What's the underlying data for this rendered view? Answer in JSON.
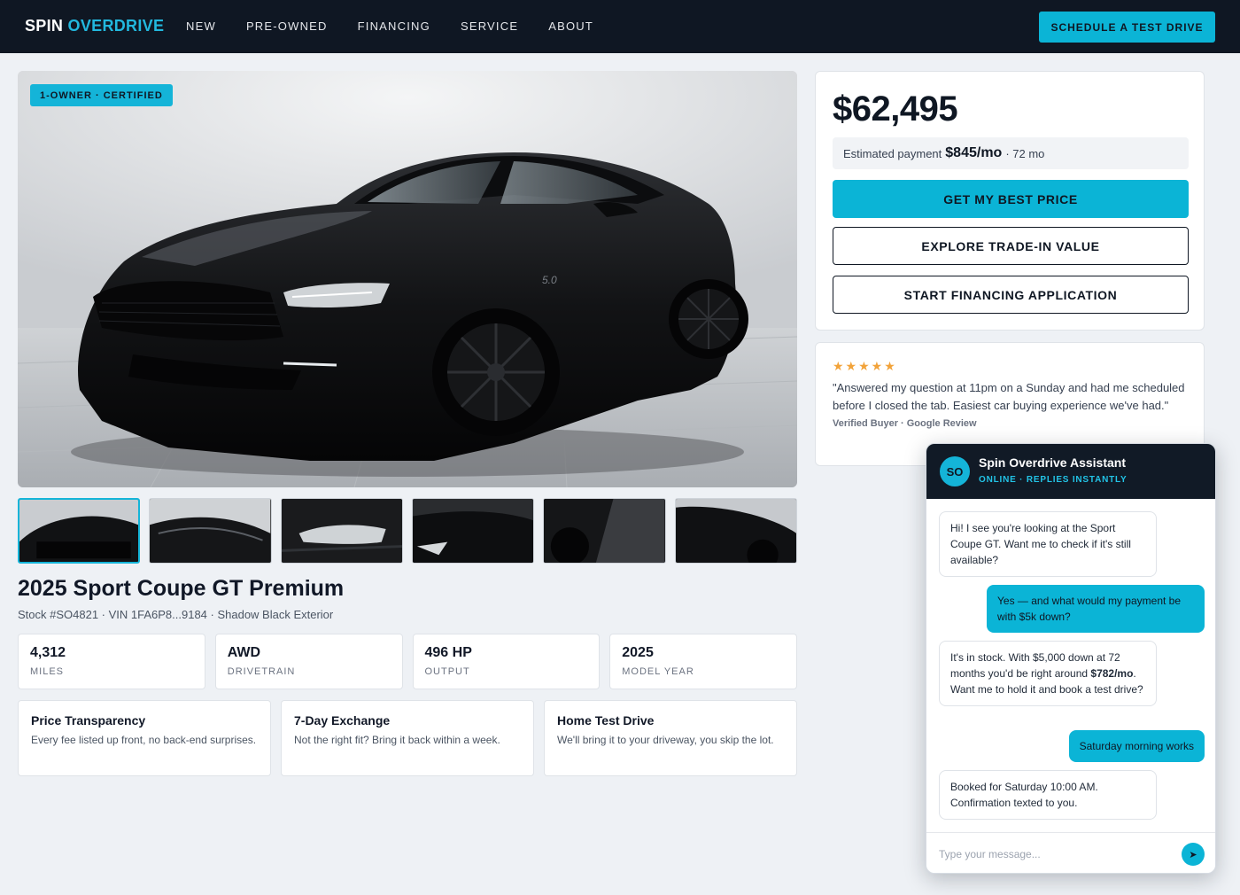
{
  "header": {
    "brand_primary": "SPIN",
    "brand_accent": "OVERDRIVE",
    "nav": [
      "NEW",
      "PRE-OWNED",
      "FINANCING",
      "SERVICE",
      "ABOUT"
    ],
    "cta": "SCHEDULE A TEST DRIVE"
  },
  "colors": {
    "accent": "#0bb4d6",
    "nav_bg": "#0f1723",
    "page_bg": "#eef1f5",
    "stars": "#f2a33a"
  },
  "listing": {
    "badge": "1-OWNER · CERTIFIED",
    "title": "2025 Sport Coupe GT Premium",
    "subtitle": "Stock #SO4821 · VIN 1FA6P8...9184 · Shadow Black Exterior",
    "thumbnail_count": 6,
    "specs": [
      {
        "value": "4,312",
        "label": "MILES"
      },
      {
        "value": "AWD",
        "label": "DRIVETRAIN"
      },
      {
        "value": "496 HP",
        "label": "OUTPUT"
      },
      {
        "value": "2025",
        "label": "MODEL YEAR"
      }
    ],
    "features": [
      {
        "title": "Price Transparency",
        "desc": "Every fee listed up front, no back-end surprises."
      },
      {
        "title": "7-Day Exchange",
        "desc": "Not the right fit? Bring it back within a week."
      },
      {
        "title": "Home Test Drive",
        "desc": "We'll bring it to your driveway, you skip the lot."
      }
    ]
  },
  "pricing": {
    "price": "$62,495",
    "est_label": "Estimated payment",
    "est_amount": "$845/mo",
    "est_term": "· 72 mo",
    "btn_best_price": "GET MY BEST PRICE",
    "btn_trade": "EXPLORE TRADE-IN VALUE",
    "btn_financing": "START FINANCING APPLICATION"
  },
  "review": {
    "stars": "★★★★★",
    "quote": "\"Answered my question at 11pm on a Sunday and had me scheduled before I closed the tab. Easiest car buying experience we've had.\"",
    "reviewer": "Verified Buyer · Google Review"
  },
  "chat": {
    "avatar": "SO",
    "title": "Spin Overdrive Assistant",
    "status": "ONLINE · REPLIES INSTANTLY",
    "messages": [
      {
        "from": "bot",
        "text": "Hi! I see you're looking at the Sport Coupe GT. Want me to check if it's still available?"
      },
      {
        "from": "user",
        "text": "Yes — and what would my payment be with $5k down?"
      },
      {
        "from": "bot",
        "text_pre": "It's in stock. With $5,000 down at 72 months you'd be right around ",
        "text_bold": "$782/mo",
        "text_post": ". Want me to hold it and book a test drive?"
      },
      {
        "from": "user",
        "text": "Saturday morning works"
      },
      {
        "from": "bot",
        "text": "Booked for Saturday 10:00 AM. Confirmation texted to you."
      }
    ],
    "input_placeholder": "Type your message...",
    "send_icon": "send-arrow-icon"
  }
}
